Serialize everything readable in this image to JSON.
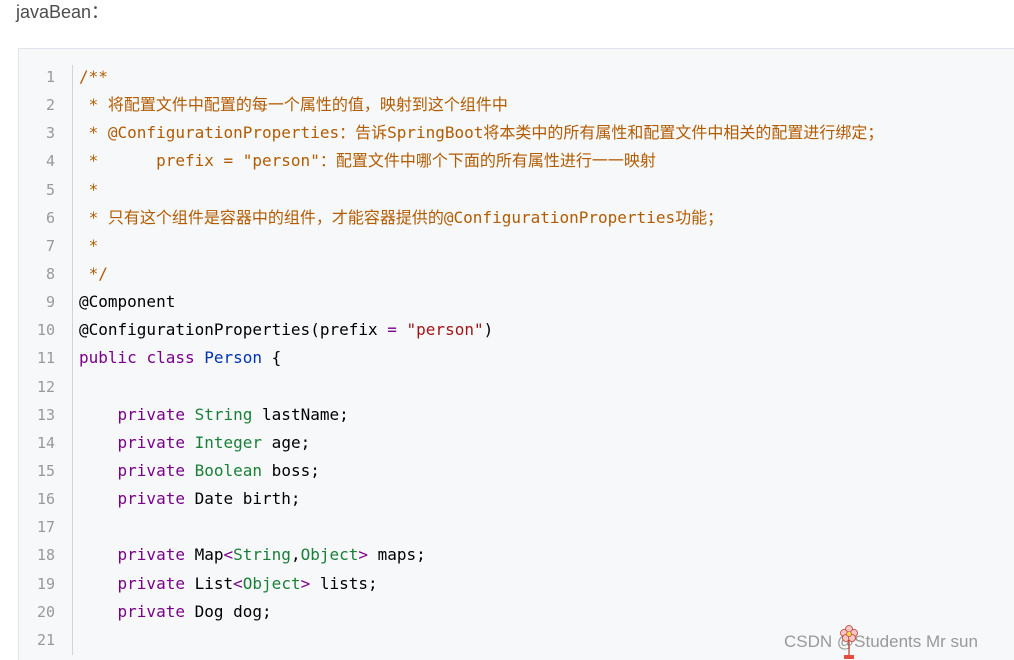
{
  "intro": {
    "text": "javaBean："
  },
  "code": {
    "lines": [
      {
        "num": "1",
        "tokens": [
          {
            "t": "/**",
            "c": "comment"
          }
        ]
      },
      {
        "num": "2",
        "tokens": [
          {
            "t": " * 将配置文件中配置的每一个属性的值，映射到这个组件中",
            "c": "comment"
          }
        ]
      },
      {
        "num": "3",
        "tokens": [
          {
            "t": " * @ConfigurationProperties：告诉SpringBoot将本类中的所有属性和配置文件中相关的配置进行绑定；",
            "c": "comment"
          }
        ]
      },
      {
        "num": "4",
        "tokens": [
          {
            "t": " *      prefix = \"person\"：配置文件中哪个下面的所有属性进行一一映射",
            "c": "comment"
          }
        ]
      },
      {
        "num": "5",
        "tokens": [
          {
            "t": " *",
            "c": "comment"
          }
        ]
      },
      {
        "num": "6",
        "tokens": [
          {
            "t": " * 只有这个组件是容器中的组件，才能容器提供的@ConfigurationProperties功能；",
            "c": "comment"
          }
        ]
      },
      {
        "num": "7",
        "tokens": [
          {
            "t": " *",
            "c": "comment"
          }
        ]
      },
      {
        "num": "8",
        "tokens": [
          {
            "t": " */",
            "c": "comment"
          }
        ]
      },
      {
        "num": "9",
        "tokens": [
          {
            "t": "@Component",
            "c": "plain"
          }
        ]
      },
      {
        "num": "10",
        "tokens": [
          {
            "t": "@ConfigurationProperties(prefix ",
            "c": "plain"
          },
          {
            "t": "=",
            "c": "op"
          },
          {
            "t": " ",
            "c": "plain"
          },
          {
            "t": "\"person\"",
            "c": "str"
          },
          {
            "t": ")",
            "c": "plain"
          }
        ]
      },
      {
        "num": "11",
        "tokens": [
          {
            "t": "public",
            "c": "kw"
          },
          {
            "t": " ",
            "c": "plain"
          },
          {
            "t": "class",
            "c": "kw"
          },
          {
            "t": " ",
            "c": "plain"
          },
          {
            "t": "Person",
            "c": "cls"
          },
          {
            "t": " {",
            "c": "plain"
          }
        ]
      },
      {
        "num": "12",
        "tokens": []
      },
      {
        "num": "13",
        "tokens": [
          {
            "t": "    ",
            "c": "plain"
          },
          {
            "t": "private",
            "c": "kw"
          },
          {
            "t": " ",
            "c": "plain"
          },
          {
            "t": "String",
            "c": "type"
          },
          {
            "t": " lastName;",
            "c": "plain"
          }
        ]
      },
      {
        "num": "14",
        "tokens": [
          {
            "t": "    ",
            "c": "plain"
          },
          {
            "t": "private",
            "c": "kw"
          },
          {
            "t": " ",
            "c": "plain"
          },
          {
            "t": "Integer",
            "c": "type"
          },
          {
            "t": " age;",
            "c": "plain"
          }
        ]
      },
      {
        "num": "15",
        "tokens": [
          {
            "t": "    ",
            "c": "plain"
          },
          {
            "t": "private",
            "c": "kw"
          },
          {
            "t": " ",
            "c": "plain"
          },
          {
            "t": "Boolean",
            "c": "type"
          },
          {
            "t": " boss;",
            "c": "plain"
          }
        ]
      },
      {
        "num": "16",
        "tokens": [
          {
            "t": "    ",
            "c": "plain"
          },
          {
            "t": "private",
            "c": "kw"
          },
          {
            "t": " Date birth;",
            "c": "plain"
          }
        ]
      },
      {
        "num": "17",
        "tokens": []
      },
      {
        "num": "18",
        "tokens": [
          {
            "t": "    ",
            "c": "plain"
          },
          {
            "t": "private",
            "c": "kw"
          },
          {
            "t": " Map",
            "c": "plain"
          },
          {
            "t": "<",
            "c": "op"
          },
          {
            "t": "String",
            "c": "type"
          },
          {
            "t": ",",
            "c": "plain"
          },
          {
            "t": "Object",
            "c": "type"
          },
          {
            "t": ">",
            "c": "op"
          },
          {
            "t": " maps;",
            "c": "plain"
          }
        ]
      },
      {
        "num": "19",
        "tokens": [
          {
            "t": "    ",
            "c": "plain"
          },
          {
            "t": "private",
            "c": "kw"
          },
          {
            "t": " List",
            "c": "plain"
          },
          {
            "t": "<",
            "c": "op"
          },
          {
            "t": "Object",
            "c": "type"
          },
          {
            "t": ">",
            "c": "op"
          },
          {
            "t": " lists;",
            "c": "plain"
          }
        ]
      },
      {
        "num": "20",
        "tokens": [
          {
            "t": "    ",
            "c": "plain"
          },
          {
            "t": "private",
            "c": "kw"
          },
          {
            "t": " Dog dog;",
            "c": "plain"
          }
        ]
      },
      {
        "num": "21",
        "tokens": []
      }
    ]
  },
  "watermark": {
    "text": "CSDN @Students Mr sun"
  },
  "colors": {
    "comment": "#b35b00",
    "keyword": "#7a0089",
    "type": "#1a7f37",
    "class": "#0033b3",
    "string": "#a31515"
  }
}
